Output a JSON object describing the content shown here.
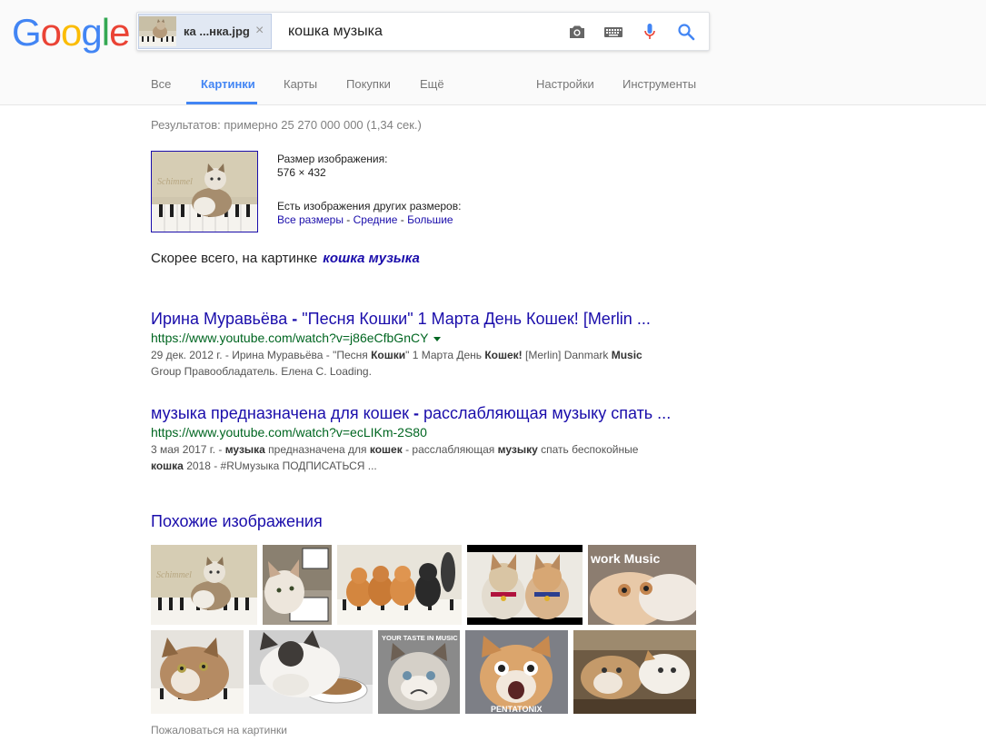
{
  "header": {
    "logo": "Google",
    "chip_filename": "ка ...нка.jpg",
    "query": "кошка музыка",
    "icons": [
      "camera-icon",
      "keyboard-icon",
      "microphone-icon",
      "search-icon"
    ]
  },
  "tabs": {
    "all": "Все",
    "images": "Картинки",
    "maps": "Карты",
    "shopping": "Покупки",
    "more": "Ещё",
    "settings": "Настройки",
    "tools": "Инструменты",
    "active": "images"
  },
  "stats": "Результатов: примерно 25 270 000 000 (1,34 сек.)",
  "image_info": {
    "size_label": "Размер изображения:",
    "size_value": "576 × 432",
    "other_sizes_label": "Есть изображения других размеров:",
    "link_all": "Все размеры",
    "sep": " - ",
    "link_medium": "Средние",
    "link_large": "Большие"
  },
  "best_guess": {
    "label": "Скорее всего, на картинке",
    "query": "кошка музыка"
  },
  "results": [
    {
      "title_a": "Ирина Муравьёва ",
      "title_b": "- ",
      "title_c": "\"Песня Кошки\" 1 Марта День Кошек! [Merlin ...",
      "url": "https://www.youtube.com/watch?v=j86eCfbGnCY",
      "snip_1": "29 дек. 2012 г. - Ирина Муравьёва - \"Песня ",
      "snip_b1": "Кошки",
      "snip_2": "\" 1 Марта День ",
      "snip_b2": "Кошек!",
      "snip_3": " [Merlin] Danmark ",
      "snip_b3": "Music",
      "snip_4": "Group Правообладатель. Елена С. Loading."
    },
    {
      "title_a": "музыка предназначена для кошек ",
      "title_b": "- ",
      "title_c": "расслабляющая музыку спать ...",
      "url": "https://www.youtube.com/watch?v=ecLIKm-2S80",
      "snip_1": "3 мая 2017 г. - ",
      "snip_b1": "музыка",
      "snip_2": " предназначена для ",
      "snip_b2": "кошек",
      "snip_3": " - расслабляющая ",
      "snip_b3": "музыку",
      "snip_4": " спать беспокойные",
      "snip_b4": "кошка",
      "snip_5": " 2018 - #RUмузыка ПОДПИСАТЬСЯ ..."
    }
  ],
  "similar": {
    "title": "Похожие изображения",
    "caption_2": "work Music",
    "caption_3": "YOUR TASTE IN MUSIC SUCKS",
    "caption_4": "PENTATONIX"
  },
  "report": "Пожаловаться на картинки",
  "colors": {
    "link": "#1a0dab",
    "url": "#006621",
    "tab_active": "#4285f4",
    "g_blue": "#4285f4",
    "g_red": "#ea4335",
    "g_yellow": "#fbbc05",
    "g_green": "#34a853"
  }
}
